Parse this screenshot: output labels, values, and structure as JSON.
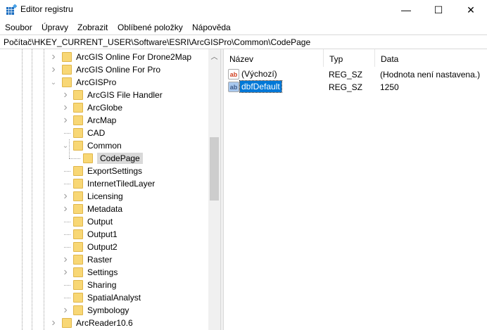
{
  "window": {
    "title": "Editor registru",
    "minimize": "—",
    "maximize": "☐",
    "close": "✕"
  },
  "menu": [
    "Soubor",
    "Úpravy",
    "Zobrazit",
    "Oblíbené položky",
    "Nápověda"
  ],
  "address": "Počítač\\HKEY_CURRENT_USER\\Software\\ESRI\\ArcGISPro\\Common\\CodePage",
  "tree": [
    {
      "label": "ArcGIS Online For Drone2Map",
      "level": 1,
      "chevron": "right"
    },
    {
      "label": "ArcGIS Online For Pro",
      "level": 1,
      "chevron": "right"
    },
    {
      "label": "ArcGISPro",
      "level": 1,
      "chevron": "down"
    },
    {
      "label": "ArcGIS File Handler",
      "level": 2,
      "chevron": "right"
    },
    {
      "label": "ArcGlobe",
      "level": 2,
      "chevron": "right"
    },
    {
      "label": "ArcMap",
      "level": 2,
      "chevron": "right"
    },
    {
      "label": "CAD",
      "level": 2,
      "chevron": "none"
    },
    {
      "label": "Common",
      "level": 2,
      "chevron": "down"
    },
    {
      "label": "CodePage",
      "level": 3,
      "chevron": "none",
      "selected": true
    },
    {
      "label": "ExportSettings",
      "level": 2,
      "chevron": "none"
    },
    {
      "label": "InternetTiledLayer",
      "level": 2,
      "chevron": "none"
    },
    {
      "label": "Licensing",
      "level": 2,
      "chevron": "right"
    },
    {
      "label": "Metadata",
      "level": 2,
      "chevron": "right"
    },
    {
      "label": "Output",
      "level": 2,
      "chevron": "none"
    },
    {
      "label": "Output1",
      "level": 2,
      "chevron": "none"
    },
    {
      "label": "Output2",
      "level": 2,
      "chevron": "none"
    },
    {
      "label": "Raster",
      "level": 2,
      "chevron": "right"
    },
    {
      "label": "Settings",
      "level": 2,
      "chevron": "right"
    },
    {
      "label": "Sharing",
      "level": 2,
      "chevron": "none"
    },
    {
      "label": "SpatialAnalyst",
      "level": 2,
      "chevron": "none"
    },
    {
      "label": "Symbology",
      "level": 2,
      "chevron": "right"
    },
    {
      "label": "ArcReader10.6",
      "level": 1,
      "chevron": "right"
    }
  ],
  "columns": [
    "Název",
    "Typ",
    "Data"
  ],
  "values": [
    {
      "name": "(Výchozí)",
      "type": "REG_SZ",
      "data": "(Hodnota není nastavena.)",
      "icon_text": "ab",
      "selected": false
    },
    {
      "name": "dbfDefault",
      "type": "REG_SZ",
      "data": "1250",
      "icon_text": "ab",
      "selected": true
    }
  ],
  "colors": {
    "selection": "#0078d7",
    "tree_selection": "#d9d9d9",
    "folder": "#f8d775"
  }
}
